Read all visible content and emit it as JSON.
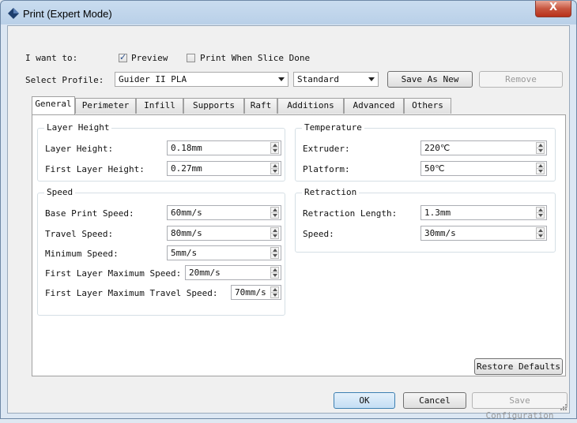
{
  "window": {
    "title": "Print (Expert Mode)",
    "close_glyph": "X"
  },
  "top": {
    "i_want_to_label": "I want to:",
    "preview_label": "Preview",
    "preview_checked": true,
    "print_when_done_label": "Print When Slice Done",
    "print_when_done_checked": false,
    "select_profile_label": "Select Profile:",
    "profile_value": "Guider II PLA",
    "quality_value": "Standard",
    "save_as_new_label": "Save As New",
    "remove_label": "Remove"
  },
  "tabs": [
    "General",
    "Perimeter",
    "Infill",
    "Supports",
    "Raft",
    "Additions",
    "Advanced",
    "Others"
  ],
  "active_tab": "General",
  "groups": {
    "layer_height": {
      "title": "Layer Height",
      "rows": [
        {
          "label": "Layer Height:",
          "value": "0.18mm"
        },
        {
          "label": "First Layer Height:",
          "value": "0.27mm"
        }
      ]
    },
    "speed": {
      "title": "Speed",
      "rows": [
        {
          "label": "Base Print Speed:",
          "value": "60mm/s"
        },
        {
          "label": "Travel Speed:",
          "value": "80mm/s"
        },
        {
          "label": "Minimum Speed:",
          "value": "5mm/s"
        },
        {
          "label": "First Layer Maximum Speed:",
          "value": "20mm/s"
        },
        {
          "label": "First Layer Maximum Travel Speed:",
          "value": "70mm/s"
        }
      ]
    },
    "temperature": {
      "title": "Temperature",
      "rows": [
        {
          "label": "Extruder:",
          "value": "220℃"
        },
        {
          "label": "Platform:",
          "value": "50℃"
        }
      ]
    },
    "retraction": {
      "title": "Retraction",
      "rows": [
        {
          "label": "Retraction Length:",
          "value": "1.3mm"
        },
        {
          "label": "Speed:",
          "value": "30mm/s"
        }
      ]
    }
  },
  "bottom": {
    "restore_defaults_label": "Restore Defaults",
    "ok_label": "OK",
    "cancel_label": "Cancel",
    "save_configuration_label": "Save Configuration"
  },
  "colors": {
    "title_bar": "#c9dcef",
    "close_button": "#c75640",
    "panel_bg": "#ffffff",
    "dialog_bg": "#f0f0f0"
  }
}
